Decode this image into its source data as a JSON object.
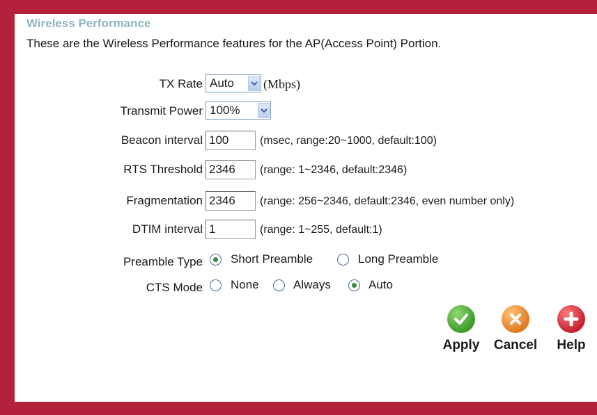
{
  "heading": "Wireless Performance",
  "description": "These are the Wireless Performance features for the AP(Access Point) Portion.",
  "colon": ":",
  "tx_rate": {
    "label": "TX Rate",
    "value": "Auto",
    "unit": "(Mbps)"
  },
  "transmit_power": {
    "label": "Transmit Power",
    "value": "100%"
  },
  "beacon_interval": {
    "label": "Beacon interval",
    "value": "100",
    "hint": "(msec, range:20~1000, default:100)"
  },
  "rts_threshold": {
    "label": "RTS Threshold",
    "value": "2346",
    "hint": "(range: 1~2346, default:2346)"
  },
  "fragmentation": {
    "label": "Fragmentation",
    "value": "2346",
    "hint": "(range: 256~2346, default:2346, even number only)"
  },
  "dtim_interval": {
    "label": "DTIM interval",
    "value": "1",
    "hint": "(range: 1~255, default:1)"
  },
  "preamble_type": {
    "label": "Preamble Type",
    "options": [
      "Short Preamble",
      "Long Preamble"
    ],
    "selected": "Short Preamble"
  },
  "cts_mode": {
    "label": "CTS Mode",
    "options": [
      "None",
      "Always",
      "Auto"
    ],
    "selected": "Auto"
  },
  "buttons": {
    "apply": "Apply",
    "cancel": "Cancel",
    "help": "Help"
  },
  "colors": {
    "frame": "#b3213b",
    "heading": "#8fb4c2",
    "apply": "#3d9a2a",
    "cancel": "#e07a1f",
    "help": "#c42031"
  },
  "icons": {
    "apply": "check-icon",
    "cancel": "x-icon",
    "help": "plus-icon",
    "dropdown": "chevron-down-icon"
  }
}
